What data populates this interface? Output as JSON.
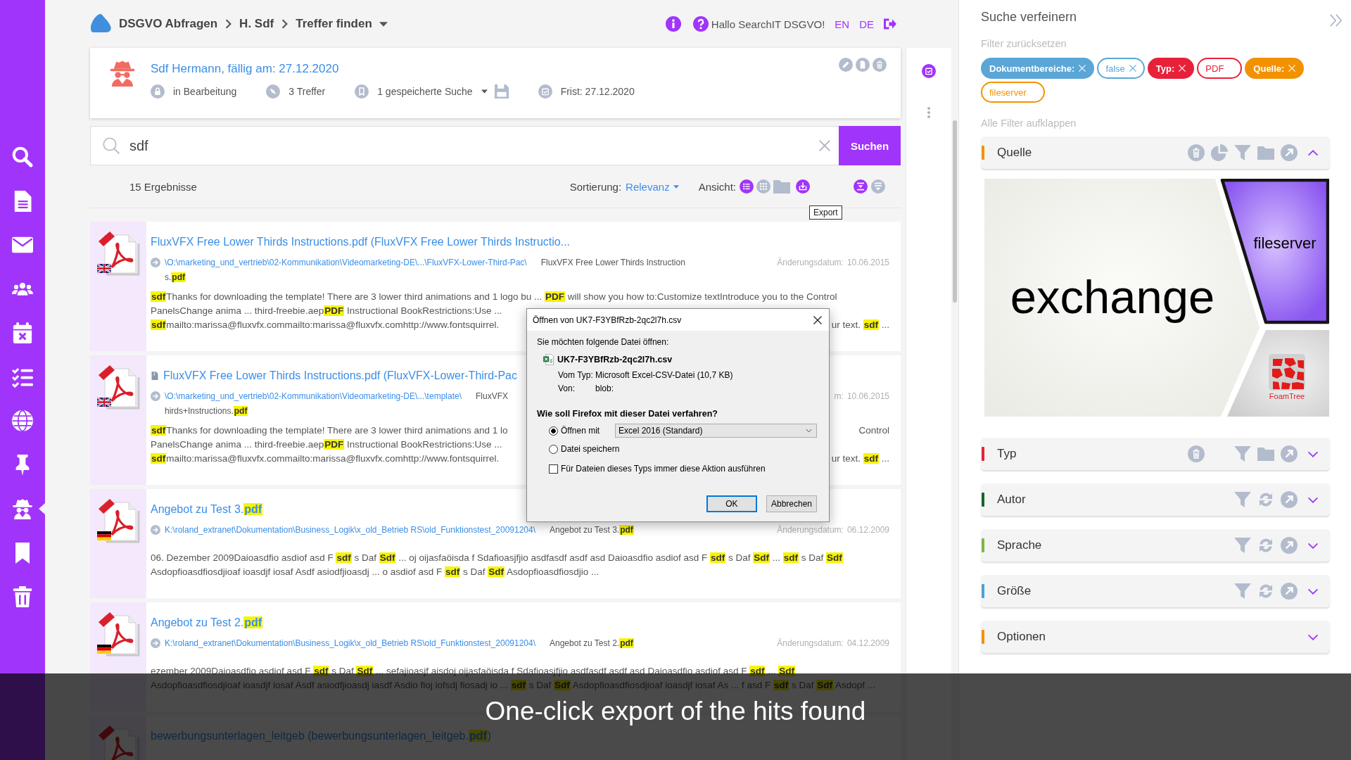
{
  "sidebar": {
    "items": [
      {
        "kind": "search",
        "selected": false
      },
      {
        "kind": "document",
        "selected": false
      },
      {
        "kind": "mail",
        "selected": false
      },
      {
        "kind": "people",
        "selected": false
      },
      {
        "kind": "calendar",
        "selected": false
      },
      {
        "kind": "checklist",
        "selected": false
      },
      {
        "kind": "globe",
        "selected": false
      },
      {
        "kind": "pin",
        "selected": false
      },
      {
        "kind": "spy",
        "selected": true
      },
      {
        "kind": "bookmark",
        "selected": false
      },
      {
        "kind": "trash",
        "selected": false
      }
    ]
  },
  "header": {
    "breadcrumbs": [
      {
        "label": "DSGVO Abfragen",
        "dropdown": false
      },
      {
        "label": "H. Sdf",
        "dropdown": false
      },
      {
        "label": "Treffer finden",
        "dropdown": true
      }
    ],
    "greeting": "Hallo SearchIT DSGVO!",
    "languages": [
      "EN",
      "DE"
    ]
  },
  "case": {
    "title": "Sdf Hermann, fällig am: 27.12.2020",
    "meta": [
      {
        "kind": "status",
        "text": "in Bearbeitung"
      },
      {
        "kind": "hits",
        "text": "3 Treffer"
      },
      {
        "kind": "saved",
        "text": "1 gespeicherte Suche"
      },
      {
        "kind": "deadline",
        "text": "Frist: 27.12.2020"
      }
    ],
    "actions": [
      {
        "kind": "edit"
      },
      {
        "kind": "document"
      },
      {
        "kind": "delete"
      }
    ]
  },
  "search": {
    "value": "sdf",
    "button": "Suchen"
  },
  "results_bar": {
    "count": "15 Ergebnisse",
    "sort_label": "Sortierung:",
    "sort_value": "Relevanz",
    "view_label": "Ansicht:",
    "views": [
      {
        "kind": "list",
        "selected": true
      },
      {
        "kind": "grid",
        "selected": false
      },
      {
        "kind": "folder",
        "selected": false
      }
    ],
    "export": {
      "hovered": true,
      "tooltip": "Export"
    },
    "toggles": [
      {
        "kind": "collapse",
        "selected": true
      },
      {
        "kind": "expand",
        "selected": false
      }
    ]
  },
  "results": [
    {
      "flag": {
        "kind": "en"
      },
      "in_archive": false,
      "title": "FluxVFX Free Lower Thirds Instructions.pdf (FluxVFX Free Lower Thirds Instructio...",
      "path": "\\O:\\marketing_und_vertrieb\\02-Kommunikation\\Videomarketing-DE\\...\\FluxVFX-Lower-Third-Pac\\",
      "file_name": "FluxVFX Free Lower Thirds Instruction",
      "file_name_wrap": "s.**pdf**",
      "date_label": "Änderungsdatum:",
      "date": "10.06.2015",
      "snippet": [
        {
          "text": "**sdf**Thanks for downloading the template! There are 3 lower third animations and 1 logo bu ... **PDF** will show you how to:Customize textIntroduce you to the Control"
        },
        {
          "text": "PanelsChange anima ... third-freebie.aep**PDF** Instructional BookRestrictions:Use ..."
        },
        {
          "text": "**sdf**mailto:marissa@fluxvfx.commailto:marissa@fluxvfx.comhttp://www.fontsquirrel.",
          "tail": "ur text. **sdf** ..."
        }
      ]
    },
    {
      "flag": {
        "kind": "en"
      },
      "in_archive": true,
      "title": "FluxVFX Free Lower Thirds Instructions.pdf (FluxVFX-Lower-Third-Pac",
      "path": "\\O:\\marketing_und_vertrieb\\02-Kommunikation\\Videomarketing-DE\\...\\template\\",
      "file_name": "FluxVFX",
      "file_name_wrap": "hirds+Instructions.**pdf**",
      "date_label": "m:",
      "date": "10.06.2015",
      "snippet": [
        {
          "text": "**sdf**Thanks for downloading the template! There are 3 lower third animations and 1 lo",
          "tail": "Control"
        },
        {
          "text": "PanelsChange anima ... third-freebie.aep**PDF** Instructional BookRestrictions:Use ..."
        },
        {
          "text": "**sdf**mailto:marissa@fluxvfx.commailto:marissa@fluxvfx.comhttp://www.fontsquirrel.",
          "tail": "ur text. **sdf** ..."
        }
      ]
    },
    {
      "flag": {
        "kind": "de"
      },
      "in_archive": false,
      "title": "Angebot zu Test 3.**pdf**",
      "path": "K:\\roland_extranet\\Dokumentation\\Business_Logik\\x_old_Betrieb RS\\old_Funktionstest_20091204\\",
      "file_name": "Angebot zu Test 3.**pdf**",
      "date_label": "Änderungsdatum:",
      "date": "06.12.2009",
      "snippet": [
        {
          "text": "06. Dezember 2009Daioasdfio asdiof asd F **sdf** s Daf **Sdf** ... oj oijasfaöisda f Sdafioasjfjio asdfasdf asdf asd Daioasdfio asdiof asd F **sdf** s Daf **Sdf** ... **sdf** s Daf **Sdf**"
        },
        {
          "text": "Asdopfioasdfiosdjioaf ioasdjf iosaf Asdf asiodfjioasdj ... o asdiof asd F **sdf** s Daf **Sdf** Asdopfioasdfiosdjio ..."
        }
      ]
    },
    {
      "flag": {
        "kind": "de"
      },
      "in_archive": false,
      "title": "Angebot zu Test 2.**pdf**",
      "path": "K:\\roland_extranet\\Dokumentation\\Business_Logik\\x_old_Betrieb RS\\old_Funktionstest_20091204\\",
      "file_name": "Angebot zu Test 2.**pdf**",
      "date_label": "Änderungsdatum:",
      "date": "04.12.2009",
      "snippet": [
        {
          "text": "ezember 2009Daioasdfio asdiof asd F **sdf** s Daf **Sdf** ... sefajioasjf aisdoj oijasfaöisda f Sdafioasjfjio asdfasdf asdf asd Daioasdfio asdiof asd F **sdf** ... **Sdf**"
        },
        {
          "text": "Asdopfioasdfiosdjioaf ioasdjf iosaf Asdf asiodfjioasdj iasdf Asdio fioj iofsdj fiosadj io ... **sdf** s Daf **Sdf** Asdopfioasdfiosdjioaf ioasdjf iosaf As ... f asd F **sdf** s Daf **Sdf** Asdopf ..."
        }
      ]
    },
    {
      "in_archive": false,
      "title": "bewerbungsunterlagen_leitgeb (bewerbungsunterlagen_leitgeb.**pdf**)"
    }
  ],
  "dialog": {
    "title": "Öffnen von UK7-F3YBfRzb-2qc2l7h.csv",
    "intro": "Sie möchten folgende Datei öffnen:",
    "file": "UK7-F3YBfRzb-2qc2l7h.csv",
    "fields": [
      {
        "label": "Vom Typ:",
        "value": "Microsoft Excel-CSV-Datei (10,7 KB)"
      },
      {
        "label": "Von:",
        "value": "blob:"
      }
    ],
    "question": "Wie soll Firefox mit dieser Datei verfahren?",
    "options": [
      {
        "label": "Öffnen mit",
        "selected": true,
        "app": "Excel 2016 (Standard)"
      },
      {
        "label": "Datei speichern",
        "selected": false
      }
    ],
    "remember": {
      "label": "Für Dateien dieses Typs immer diese Aktion ausführen",
      "checked": false
    },
    "buttons": [
      {
        "label": "OK",
        "focused": true
      },
      {
        "label": "Abbrechen",
        "focused": false
      }
    ]
  },
  "refine": {
    "title": "Suche verfeinern",
    "reset": "Filter zurücksetzen",
    "chips": [
      {
        "kind": "key",
        "label": "Dokumentbereiche:",
        "removable": true,
        "color": "#5aa6d7"
      },
      {
        "kind": "value",
        "label": "false",
        "removable": true,
        "color": "#5aa6d7"
      },
      {
        "kind": "key",
        "label": "Typ:",
        "removable": true,
        "color": "#e8213a"
      },
      {
        "kind": "value",
        "label": "PDF",
        "removable": false,
        "color": "#e8213a"
      },
      {
        "kind": "key",
        "label": "Quelle:",
        "removable": true,
        "color": "#f39200"
      },
      {
        "kind": "value",
        "label": "fileserver",
        "removable": false,
        "color": "#f39200"
      }
    ],
    "expand_all": "Alle Filter aufklappen",
    "facets": [
      {
        "label": "Quelle",
        "color": "#f39200",
        "expanded": true,
        "clearable": true,
        "tools": [
          {
            "kind": "chart"
          },
          {
            "kind": "filter"
          },
          {
            "kind": "folder"
          },
          {
            "kind": "open"
          }
        ],
        "foamtree": {
          "cells": [
            {
              "label": "exchange",
              "selected": false
            },
            {
              "label": "fileserver",
              "selected": true
            }
          ],
          "logo": "FoamTree"
        }
      },
      {
        "label": "Typ",
        "color": "#e8213a",
        "expanded": false,
        "clearable": true,
        "tools": [
          {
            "kind": "filter"
          },
          {
            "kind": "folder"
          },
          {
            "kind": "open"
          }
        ]
      },
      {
        "label": "Autor",
        "color": "#17632e",
        "expanded": false,
        "clearable": false,
        "tools": [
          {
            "kind": "filter"
          },
          {
            "kind": "refresh"
          },
          {
            "kind": "open"
          }
        ]
      },
      {
        "label": "Sprache",
        "color": "#7bb843",
        "expanded": false,
        "clearable": false,
        "tools": [
          {
            "kind": "filter"
          },
          {
            "kind": "refresh"
          },
          {
            "kind": "open"
          }
        ]
      },
      {
        "label": "Größe",
        "color": "#4aa2d8",
        "expanded": false,
        "clearable": false,
        "tools": [
          {
            "kind": "filter"
          },
          {
            "kind": "refresh"
          },
          {
            "kind": "open"
          }
        ]
      },
      {
        "label": "Optionen",
        "color": "#f39200",
        "expanded": false,
        "clearable": false
      }
    ]
  },
  "caption": "One-click export of the hits found"
}
